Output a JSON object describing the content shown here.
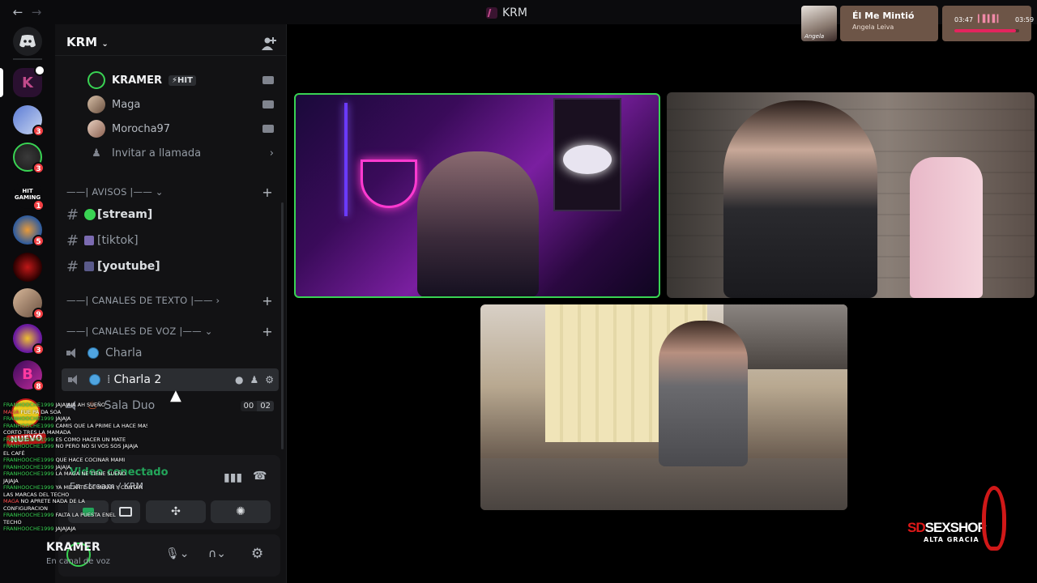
{
  "window": {
    "title": "KRM",
    "back": "←",
    "forward": "→"
  },
  "now_playing": {
    "song": "Él Me Mintió",
    "artist": "Angela Leiva",
    "elapsed": "03:47",
    "duration": "03:59",
    "progress": 0.95,
    "art_caption": "Angela"
  },
  "rail": {
    "servers": [
      {
        "name": "discord-home",
        "badge": null
      },
      {
        "name": "krm",
        "badge": null
      },
      {
        "name": "server-3",
        "badge": "3"
      },
      {
        "name": "server-4",
        "badge": "3"
      },
      {
        "name": "server-5",
        "badge": "1",
        "label": "HIT GAMING"
      },
      {
        "name": "server-6",
        "badge": "5"
      },
      {
        "name": "server-7",
        "badge": null
      },
      {
        "name": "server-8",
        "badge": "9"
      },
      {
        "name": "server-9",
        "badge": "3"
      },
      {
        "name": "server-10",
        "badge": "8"
      }
    ]
  },
  "sidebar": {
    "server_name": "KRM",
    "members": [
      {
        "name": "KRAMER",
        "tag": "HIT"
      },
      {
        "name": "Maga"
      },
      {
        "name": "Morocha97"
      }
    ],
    "invite": "Invitar a llamada",
    "cat_avisos": "——| AVISOS |——",
    "text_channels": [
      "[stream]",
      "[tiktok]",
      "[youtube]"
    ],
    "cat_texto": "——| CANALES DE TEXTO |——",
    "cat_voz": "——| CANALES DE VOZ |——",
    "voice_channels": [
      {
        "name": "Charla"
      },
      {
        "name": "Charla 2"
      },
      {
        "name": "Sala Duo",
        "count_a": "00",
        "count_b": "02"
      }
    ]
  },
  "voice_panel": {
    "status": "Video conectado",
    "channel": "En stream / KRM"
  },
  "user_panel": {
    "name": "KRAMER",
    "status": "En canal de voz"
  },
  "chat_overlay": {
    "nuevo": "NUEVO",
    "lines": [
      {
        "user": "FRANHOOCHE1999",
        "text": "JAJAJAJA AH SUEÑO"
      },
      {
        "user": "MAGA",
        "text": "FUE PA DA SOA",
        "alt": true
      },
      {
        "user": "FRANHOOCHE1999",
        "text": "JAJAJA"
      },
      {
        "user": "FRANHOOCHE1999",
        "text": "CAMIS QUE LA PRIME LA HACE MAS"
      },
      {
        "user": "",
        "text": "CORTO TRES LA MAMADA"
      },
      {
        "user": "FRANHOOCHE1999",
        "text": "ES COMO HACER UN MATE"
      },
      {
        "user": "FRANHOOCHE1999",
        "text": "NO PERO NO SI VOS SOS JAJAJA"
      },
      {
        "user": "",
        "text": "EL CAFÉ"
      },
      {
        "user": "FRANHOOCHE1999",
        "text": "QUE HACE COCINAR MAMI"
      },
      {
        "user": "FRANHOOCHE1999",
        "text": "JAJAJA"
      },
      {
        "user": "FRANHOOCHE1999",
        "text": "LA MAGA NE TIENE SUEÑO"
      },
      {
        "user": "",
        "text": "JAJAJA"
      },
      {
        "user": "FRANHOOCHE1999",
        "text": "YA ME ARTE DE MIRAR Y CONTAR"
      },
      {
        "user": "",
        "text": "LAS MARCAS DEL TECHO"
      },
      {
        "user": "MAGA",
        "text": "NO APRETE NADA DE LA",
        "alt": true
      },
      {
        "user": "",
        "text": "CONFIGURACION"
      },
      {
        "user": "FRANHOOCHE1999",
        "text": "FALTA LA PUESTA ENEL"
      },
      {
        "user": "",
        "text": "TECHO"
      },
      {
        "user": "FRANHOOCHE1999",
        "text": "JAJAJAJA"
      }
    ]
  },
  "brand": {
    "line1": "SEXSHOP",
    "prefix": "SD",
    "line2": "ALTA GRACIA"
  },
  "colors": {
    "speaking": "#39d353",
    "badge": "#f23f43",
    "accent": "#e4245e"
  }
}
